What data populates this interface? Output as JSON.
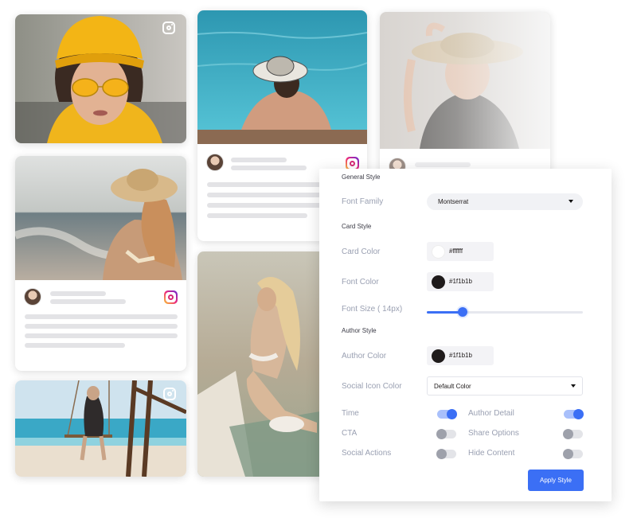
{
  "panel": {
    "general_style": "General Style",
    "font_family_label": "Font Family",
    "font_family_value": "Montserrat",
    "card_style": "Card Style",
    "card_color_label": "Card Color",
    "card_color_value": "#ffffff",
    "font_color_label": "Font Color",
    "font_color_value": "#1f1b1b",
    "font_size_label": "Font Size ( 14px)",
    "font_size_slider_fraction": 0.23,
    "author_style": "Author Style",
    "author_color_label": "Author Color",
    "author_color_value": "#1f1b1b",
    "social_icon_color_label": "Social Icon Color",
    "social_icon_color_value": "Default Color",
    "toggles": [
      {
        "label": "Time",
        "on": true
      },
      {
        "label": "Author Detail",
        "on": true
      },
      {
        "label": "CTA",
        "on": false
      },
      {
        "label": "Share Options",
        "on": false
      },
      {
        "label": "Social Actions",
        "on": false
      },
      {
        "label": "Hide Content",
        "on": false
      }
    ],
    "apply_label": "Apply Style"
  },
  "colors": {
    "accent": "#3b6ff5",
    "card": "#ffffff",
    "font": "#1f1b1b"
  },
  "icons": [
    "instagram-icon",
    "chevron-down-icon"
  ]
}
